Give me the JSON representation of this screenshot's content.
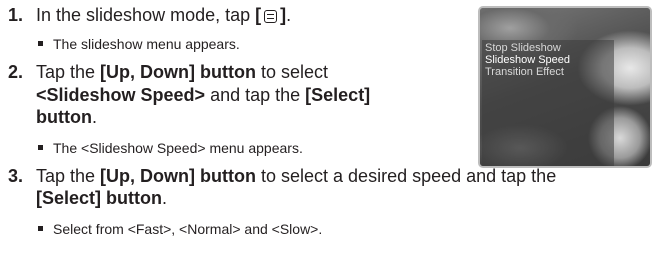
{
  "steps": [
    {
      "num": "1.",
      "lines": [
        {
          "pre": "In the slideshow mode, tap ",
          "bold_open": "[",
          "bold_close": "]",
          "post": "."
        }
      ],
      "sub": "The slideshow menu appears."
    },
    {
      "num": "2.",
      "line1": {
        "pre": "Tap the ",
        "bold": "[Up, Down] button",
        "post": " to select"
      },
      "line2": {
        "bold": "<Slideshow Speed>",
        "mid": " and tap the ",
        "bold2": "[Select]"
      },
      "line3": {
        "bold": "button",
        "post": "."
      },
      "sub": "The <Slideshow Speed> menu appears."
    },
    {
      "num": "3.",
      "line1": {
        "pre": "Tap the ",
        "bold": "[Up, Down] button",
        "post": " to select a desired speed and tap the"
      },
      "line2": {
        "bold": "[Select] button",
        "post": "."
      },
      "sub": "Select from <Fast>, <Normal> and <Slow>."
    }
  ],
  "device_menu": {
    "items": [
      "Stop Slideshow",
      "Slideshow Speed",
      "Transition Effect"
    ],
    "selected_index": 1
  }
}
